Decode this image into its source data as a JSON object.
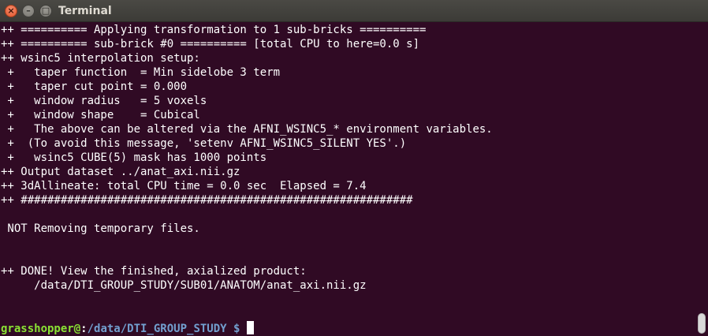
{
  "window": {
    "title": "Terminal",
    "close_glyph": "×",
    "minimize_glyph": "–",
    "maximize_glyph": "□"
  },
  "terminal": {
    "lines": [
      "++ ========== Applying transformation to 1 sub-bricks ==========",
      "++ ========== sub-brick #0 ========== [total CPU to here=0.0 s]",
      "++ wsinc5 interpolation setup:",
      " +   taper function  = Min sidelobe 3 term",
      " +   taper cut point = 0.000",
      " +   window radius   = 5 voxels",
      " +   window shape    = Cubical",
      " +   The above can be altered via the AFNI_WSINC5_* environment variables.",
      " +  (To avoid this message, 'setenv AFNI_WSINC5_SILENT YES'.)",
      " +   wsinc5 CUBE(5) mask has 1000 points",
      "++ Output dataset ../anat_axi.nii.gz",
      "++ 3dAllineate: total CPU time = 0.0 sec  Elapsed = 7.4",
      "++ ###########################################################",
      "",
      " NOT Removing temporary files.",
      "",
      "",
      "++ DONE! View the finished, axialized product:",
      "     /data/DTI_GROUP_STUDY/SUB01/ANATOM/anat_axi.nii.gz",
      "",
      ""
    ],
    "prompt": {
      "user": "grasshopper@",
      "sep": ":",
      "path": "/data/DTI_GROUP_STUDY",
      "symbol": " $ "
    }
  },
  "colors": {
    "background": "#300a24",
    "text": "#ffffff",
    "prompt_user": "#8ae234",
    "prompt_path": "#729fcf"
  }
}
